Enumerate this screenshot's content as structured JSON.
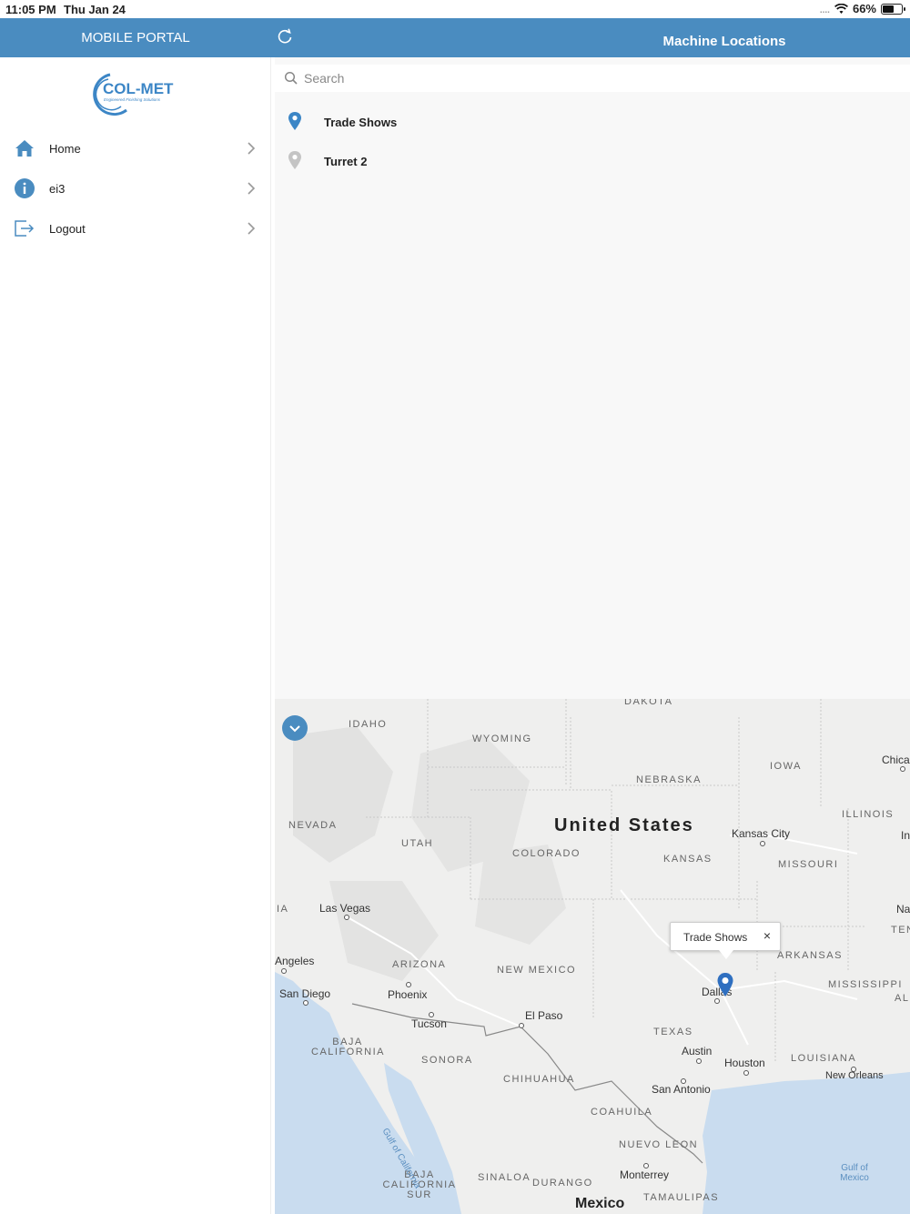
{
  "status_bar": {
    "time": "11:05 PM",
    "date": "Thu Jan 24",
    "signal": "....",
    "battery": "66%"
  },
  "nav": {
    "left_title": "MOBILE PORTAL",
    "right_title": "Machine Locations",
    "refresh_icon": "refresh-icon"
  },
  "sidebar": {
    "logo_text": "COL-MET",
    "logo_tagline": "Engineered Finishing Solutions",
    "items": [
      {
        "label": "Home",
        "icon": "home-icon"
      },
      {
        "label": "ei3",
        "icon": "info-icon"
      },
      {
        "label": "Logout",
        "icon": "logout-icon"
      }
    ]
  },
  "search": {
    "placeholder": "Search",
    "value": ""
  },
  "locations": [
    {
      "name": "Trade Shows",
      "pin_color": "#3c86c6"
    },
    {
      "name": "Turret 2",
      "pin_color": "#c4c4c4"
    }
  ],
  "map": {
    "country": "United States",
    "country_mexico": "Mexico",
    "states": [
      "DAKOTA",
      "IDAHO",
      "WYOMING",
      "NEBRASKA",
      "IOWA",
      "ILLINOIS",
      "NEVADA",
      "UTAH",
      "COLORADO",
      "KANSAS",
      "MISSOURI",
      "ARIZONA",
      "NEW MEXICO",
      "ARKANSAS",
      "MISSISSIPPI",
      "TEXAS",
      "LOUISIANA",
      "BAJA CALIFORNIA",
      "SONORA",
      "CHIHUAHUA",
      "COAHUILA",
      "NUEVO LEON",
      "BAJA CALIFORNIA SUR",
      "SINALOA",
      "DURANGO",
      "TAMAULIPAS",
      "IA",
      "TEN",
      "AL"
    ],
    "cities": [
      "Chica",
      "Kansas City",
      "In",
      "Na",
      "Las Vegas",
      "Angeles",
      "San Diego",
      "Phoenix",
      "Tucson",
      "El Paso",
      "Dallas",
      "Austin",
      "Houston",
      "San Antonio",
      "New Orleans",
      "Monterrey"
    ],
    "water": [
      "Gulf of California",
      "Gulf of Mexico"
    ],
    "callout_title": "Trade Shows",
    "callout_close": "×"
  },
  "colors": {
    "nav_bg": "#4a8cc0",
    "accent": "#3c86c6"
  }
}
